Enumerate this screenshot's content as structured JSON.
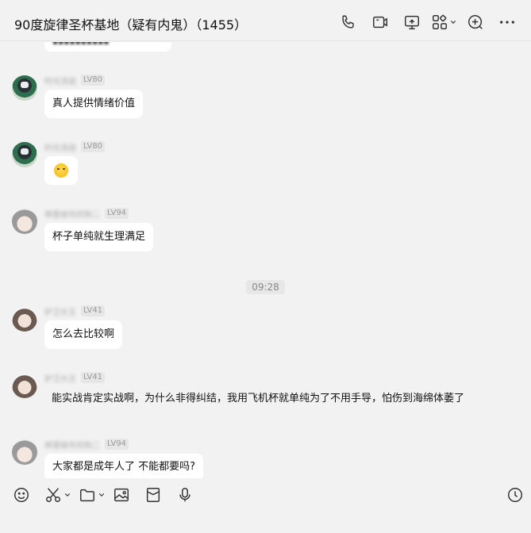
{
  "header": {
    "title": "90度旋律圣杯基地（疑有内鬼）（1455）",
    "actions": [
      "phone-icon",
      "video-icon",
      "screen-share-icon",
      "apps-icon",
      "add-member-icon",
      "more-icon"
    ]
  },
  "messages": [
    {
      "level": "LV80",
      "text": "真人提供情绪价值"
    },
    {
      "level": "LV80",
      "text": ""
    },
    {
      "level": "LV94",
      "text": "杯子单纯就生理满足"
    },
    {
      "level": "LV41",
      "text": "怎么去比较啊"
    },
    {
      "level": "LV41",
      "text": "能实战肯定实战啊，为什么非得纠结，我用飞机杯就单纯为了不用手导，怕伤到海绵体萎了"
    },
    {
      "level": "LV94",
      "text": "大家都是成年人了 不能都要吗?"
    }
  ],
  "timestamp": "09:28",
  "toolbar": [
    "emoji-icon",
    "scissors-icon",
    "folder-icon",
    "image-icon",
    "red-packet-icon",
    "mic-icon",
    "history-clock-icon"
  ],
  "colors": {
    "background": "#f2f2f2",
    "bubble": "#ffffff",
    "text": "#111111",
    "muted": "#999999"
  }
}
